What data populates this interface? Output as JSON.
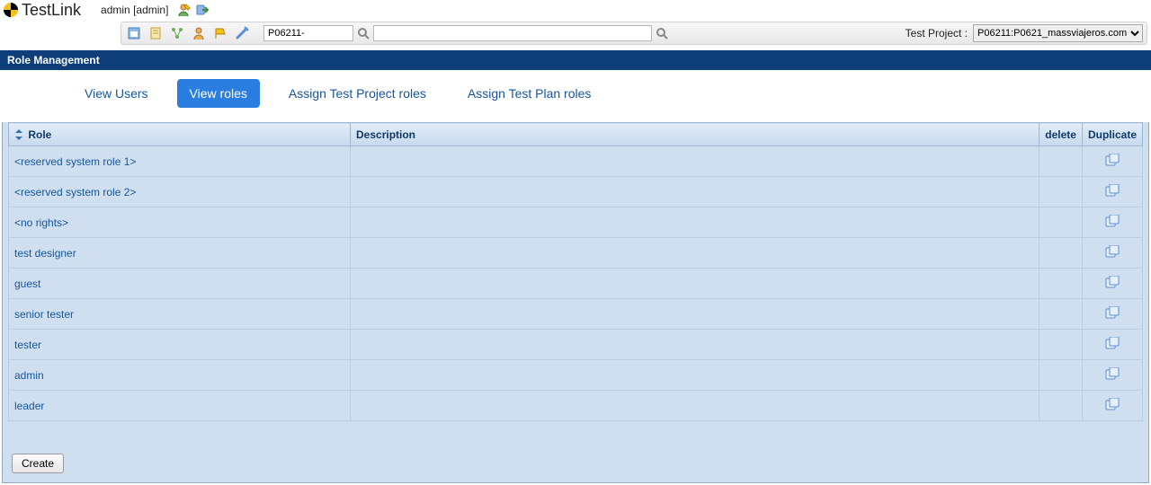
{
  "app": {
    "name": "TestLink"
  },
  "user": {
    "label": "admin [admin]"
  },
  "toolbar": {
    "search_small_value": "P06211-",
    "search_large_value": "",
    "project_label": "Test Project :",
    "project_selected": "P06211:P0621_massviajeros.com"
  },
  "page": {
    "title": "Role Management"
  },
  "tabs": [
    {
      "label": "View Users",
      "active": false
    },
    {
      "label": "View roles",
      "active": true
    },
    {
      "label": "Assign Test Project roles",
      "active": false
    },
    {
      "label": "Assign Test Plan roles",
      "active": false
    }
  ],
  "table": {
    "headers": {
      "role": "Role",
      "description": "Description",
      "delete": "delete",
      "duplicate": "Duplicate"
    },
    "rows": [
      {
        "role": "<reserved system role 1>",
        "description": ""
      },
      {
        "role": "<reserved system role 2>",
        "description": ""
      },
      {
        "role": "<no rights>",
        "description": ""
      },
      {
        "role": "test designer",
        "description": ""
      },
      {
        "role": "guest",
        "description": ""
      },
      {
        "role": "senior tester",
        "description": ""
      },
      {
        "role": "tester",
        "description": ""
      },
      {
        "role": "admin",
        "description": ""
      },
      {
        "role": "leader",
        "description": ""
      }
    ]
  },
  "buttons": {
    "create": "Create"
  }
}
